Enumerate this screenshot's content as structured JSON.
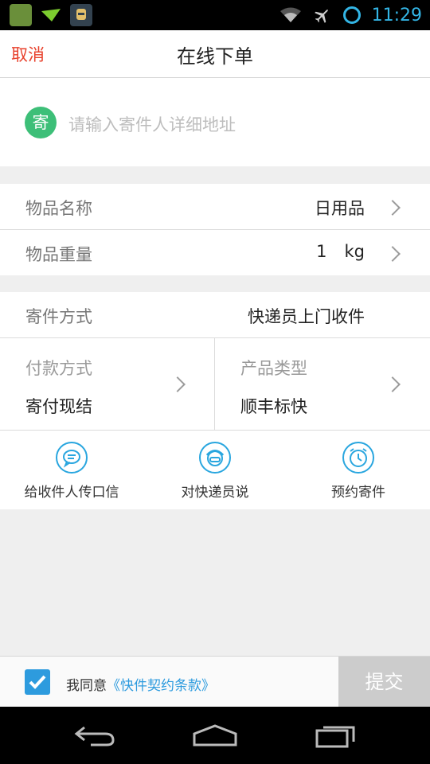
{
  "status": {
    "time": "11:29"
  },
  "header": {
    "cancel_label": "取消",
    "title": "在线下单"
  },
  "sender": {
    "badge": "寄",
    "placeholder": "请输入寄件人详细地址"
  },
  "item_name": {
    "label": "物品名称",
    "value": "日用品"
  },
  "item_weight": {
    "label": "物品重量",
    "value": "1",
    "unit": "kg"
  },
  "ship_method": {
    "label": "寄件方式",
    "value": "快递员上门收件"
  },
  "payment": {
    "label": "付款方式",
    "value": "寄付现结"
  },
  "product": {
    "label": "产品类型",
    "value": "顺丰标快"
  },
  "actions": [
    {
      "label": "给收件人传口信",
      "icon": "message-bubble-icon"
    },
    {
      "label": "对快递员说",
      "icon": "courier-face-icon"
    },
    {
      "label": "预约寄件",
      "icon": "alarm-clock-icon"
    }
  ],
  "footer": {
    "agree_prefix": "我同意",
    "agree_link": "《快件契约条款》",
    "submit_label": "提交",
    "agreed": true
  },
  "colors": {
    "accent": "#2d9bde",
    "cancel": "#e8412c",
    "badge": "#3dbf78",
    "submit_disabled": "#cccccc"
  }
}
